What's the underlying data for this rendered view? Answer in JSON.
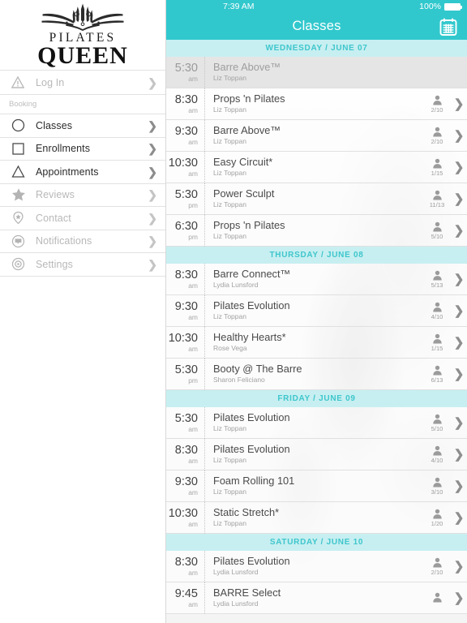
{
  "brand": {
    "logo_line1": "PILATES",
    "logo_line2": "QUEEN",
    "emblem_icon": "crown-emblem"
  },
  "colors": {
    "teal": "#31c8cd",
    "day_header_bg": "#c7eff1",
    "day_header_text": "#3ec6cc"
  },
  "statusbar": {
    "time": "7:39 AM",
    "battery_percent": "100%"
  },
  "navbar": {
    "title": "Classes",
    "calendar_icon": "calendar-icon"
  },
  "sidebar": {
    "login": {
      "label": "Log In",
      "icon": "warning-triangle-icon",
      "chevron": "❯"
    },
    "section_label": "Booking",
    "items": [
      {
        "label": "Classes",
        "icon": "circle-icon",
        "active": true,
        "chevron": "❯"
      },
      {
        "label": "Enrollments",
        "icon": "square-icon",
        "active": true,
        "chevron": "❯"
      },
      {
        "label": "Appointments",
        "icon": "triangle-icon",
        "active": true,
        "chevron": "❯"
      },
      {
        "label": "Reviews",
        "icon": "star-icon",
        "active": false,
        "chevron": "❯"
      },
      {
        "label": "Contact",
        "icon": "location-pin-icon",
        "active": false,
        "chevron": "❯"
      },
      {
        "label": "Notifications",
        "icon": "chat-bubble-icon",
        "active": false,
        "chevron": "❯"
      },
      {
        "label": "Settings",
        "icon": "gear-icon",
        "active": false,
        "chevron": "❯"
      }
    ]
  },
  "schedule": {
    "person_icon": "person-icon",
    "row_chevron": "❯",
    "days": [
      {
        "header": "WEDNESDAY / JUNE 07",
        "classes": [
          {
            "time": "5:30",
            "meridiem": "am",
            "title": "Barre Above™",
            "instructor": "Liz Toppan",
            "count": "",
            "past": true
          },
          {
            "time": "8:30",
            "meridiem": "am",
            "title": "Props 'n Pilates",
            "instructor": "Liz Toppan",
            "count": "2/10",
            "past": false
          },
          {
            "time": "9:30",
            "meridiem": "am",
            "title": "Barre Above™",
            "instructor": "Liz Toppan",
            "count": "2/10",
            "past": false
          },
          {
            "time": "10:30",
            "meridiem": "am",
            "title": "Easy Circuit*",
            "instructor": "Liz Toppan",
            "count": "1/15",
            "past": false
          },
          {
            "time": "5:30",
            "meridiem": "pm",
            "title": "Power Sculpt",
            "instructor": "Liz Toppan",
            "count": "11/13",
            "past": false
          },
          {
            "time": "6:30",
            "meridiem": "pm",
            "title": "Props 'n Pilates",
            "instructor": "Liz Toppan",
            "count": "5/10",
            "past": false
          }
        ]
      },
      {
        "header": "THURSDAY / JUNE 08",
        "classes": [
          {
            "time": "8:30",
            "meridiem": "am",
            "title": "Barre Connect™",
            "instructor": "Lydia Lunsford",
            "count": "5/13",
            "past": false
          },
          {
            "time": "9:30",
            "meridiem": "am",
            "title": "Pilates Evolution",
            "instructor": "Liz Toppan",
            "count": "4/10",
            "past": false
          },
          {
            "time": "10:30",
            "meridiem": "am",
            "title": "Healthy Hearts*",
            "instructor": "Rose Vega",
            "count": "1/15",
            "past": false
          },
          {
            "time": "5:30",
            "meridiem": "pm",
            "title": "Booty @ The Barre",
            "instructor": "Sharon Feliciano",
            "count": "6/13",
            "past": false
          }
        ]
      },
      {
        "header": "FRIDAY / JUNE 09",
        "classes": [
          {
            "time": "5:30",
            "meridiem": "am",
            "title": "Pilates Evolution",
            "instructor": "Liz Toppan",
            "count": "5/10",
            "past": false
          },
          {
            "time": "8:30",
            "meridiem": "am",
            "title": "Pilates Evolution",
            "instructor": "Liz Toppan",
            "count": "4/10",
            "past": false
          },
          {
            "time": "9:30",
            "meridiem": "am",
            "title": "Foam Rolling 101",
            "instructor": "Liz Toppan",
            "count": "3/10",
            "past": false
          },
          {
            "time": "10:30",
            "meridiem": "am",
            "title": "Static Stretch*",
            "instructor": "Liz Toppan",
            "count": "1/20",
            "past": false
          }
        ]
      },
      {
        "header": "SATURDAY / JUNE 10",
        "classes": [
          {
            "time": "8:30",
            "meridiem": "am",
            "title": "Pilates Evolution",
            "instructor": "Lydia Lunsford",
            "count": "2/10",
            "past": false
          },
          {
            "time": "9:45",
            "meridiem": "am",
            "title": "BARRE Select",
            "instructor": "Lydia Lunsford",
            "count": "",
            "past": false
          }
        ]
      }
    ]
  }
}
